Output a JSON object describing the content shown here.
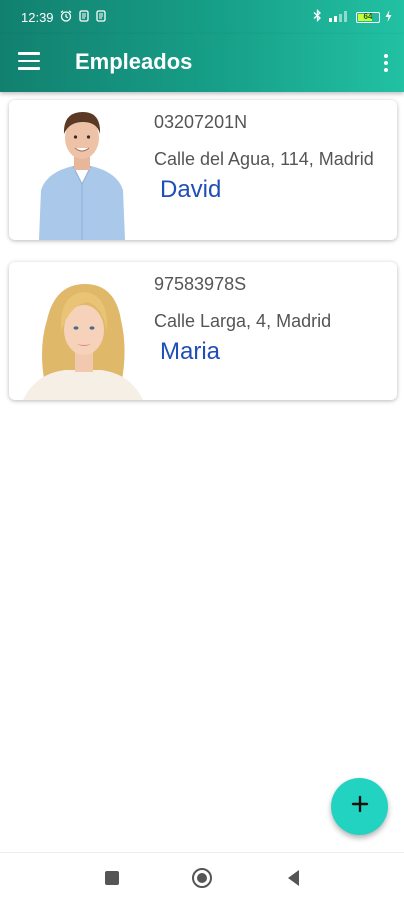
{
  "status_bar": {
    "time": "12:39",
    "left_icons": [
      "alarm-icon",
      "notification-icon",
      "notification-icon"
    ],
    "right_icons": [
      "bluetooth-icon",
      "signal-icon",
      "battery-icon",
      "charging-icon"
    ],
    "battery_level": "64"
  },
  "app_bar": {
    "title": "Empleados",
    "menu_icon": "hamburger-menu-icon",
    "overflow_icon": "more-vert-icon",
    "color": "#17a089"
  },
  "employees": [
    {
      "dni": "03207201N",
      "address": "Calle del Agua, 114, Madrid",
      "name": "David"
    },
    {
      "dni": "97583978S",
      "address": "Calle Larga, 4, Madrid",
      "name": "Maria"
    }
  ],
  "fab": {
    "icon": "plus-icon",
    "color": "#22d3c2"
  },
  "nav_bar": {
    "buttons": [
      "recent-apps-icon",
      "home-icon",
      "back-icon"
    ]
  },
  "colors": {
    "name_text": "#1f4fb6",
    "secondary_text": "#555555"
  }
}
